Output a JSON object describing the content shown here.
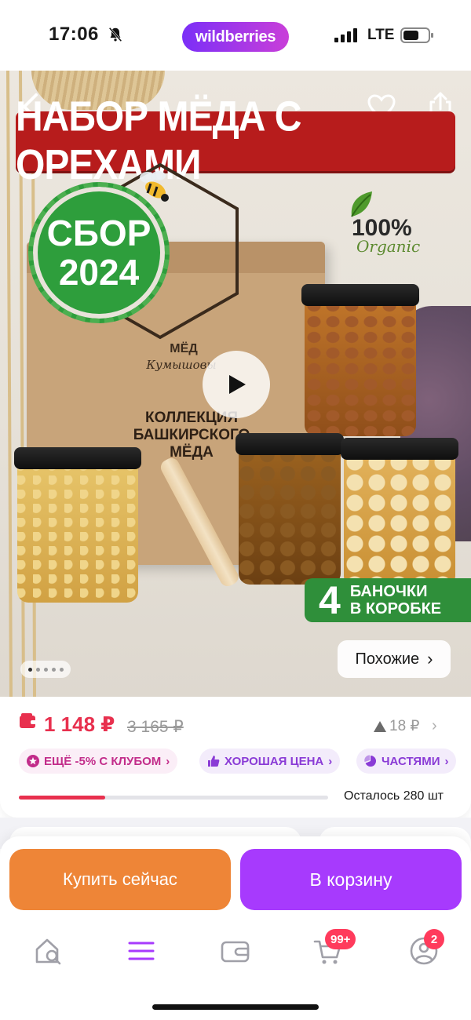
{
  "status_bar": {
    "time": "17:06",
    "brand": "wildberries",
    "network": "LTE"
  },
  "hero": {
    "banner_title": "НАБОР МЁДА С ОРЕХАМИ",
    "harvest_line1": "СБОР",
    "harvest_line2": "2024",
    "organic_pct": "100%",
    "organic_word": "Organic",
    "box_brand": "МЁД",
    "box_brand_sub": "Кумышовы",
    "box_collection": "КОЛЛЕКЦИЯ БАШКИРСКОГО МЁДА",
    "count_number": "4",
    "count_text_l1": "БАНОЧКИ",
    "count_text_l2": "В КОРОБКЕ",
    "similar_label": "Похожие",
    "similar_chevron": "›",
    "pager": {
      "count": 5,
      "active_index": 0
    }
  },
  "price": {
    "current": "1 148 ₽",
    "old": "3 165 ₽",
    "change": "18 ₽",
    "chevron": "›"
  },
  "pills": {
    "club": "ЕЩЁ -5% С КЛУБОМ",
    "good_price": "ХОРОШАЯ ЦЕНА",
    "installments": "ЧАСТЯМИ",
    "chevron": "›"
  },
  "stock": {
    "fraction": 0.28,
    "text": "Осталось 280 шт"
  },
  "actions": {
    "buy_now": "Купить сейчас",
    "add_to_cart": "В корзину"
  },
  "tabbar": {
    "cart_badge": "99+",
    "profile_badge": "2"
  },
  "colors": {
    "accent_purple": "#a73afd",
    "accent_orange": "#ee8537",
    "price_red": "#e8304e"
  }
}
